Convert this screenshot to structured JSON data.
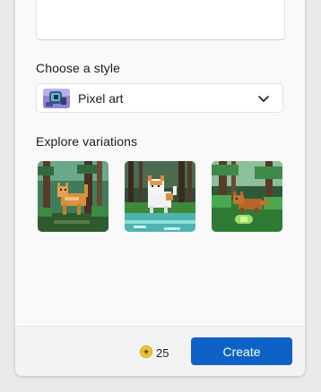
{
  "style_section": {
    "label": "Choose a style",
    "selected": "Pixel art",
    "chevron_icon": "chevron-down-icon"
  },
  "variations_section": {
    "label": "Explore variations",
    "items": [
      {
        "description_icon": "pixel-cat-forest-image"
      },
      {
        "description_icon": "pixel-cat-stream-image"
      },
      {
        "description_icon": "pixel-fox-forest-image"
      }
    ]
  },
  "footer": {
    "coin_icon": "coin-sparkle-icon",
    "credits": "25",
    "create_label": "Create"
  },
  "colors": {
    "accent": "#0f62c5",
    "coin": "#f4c430"
  }
}
